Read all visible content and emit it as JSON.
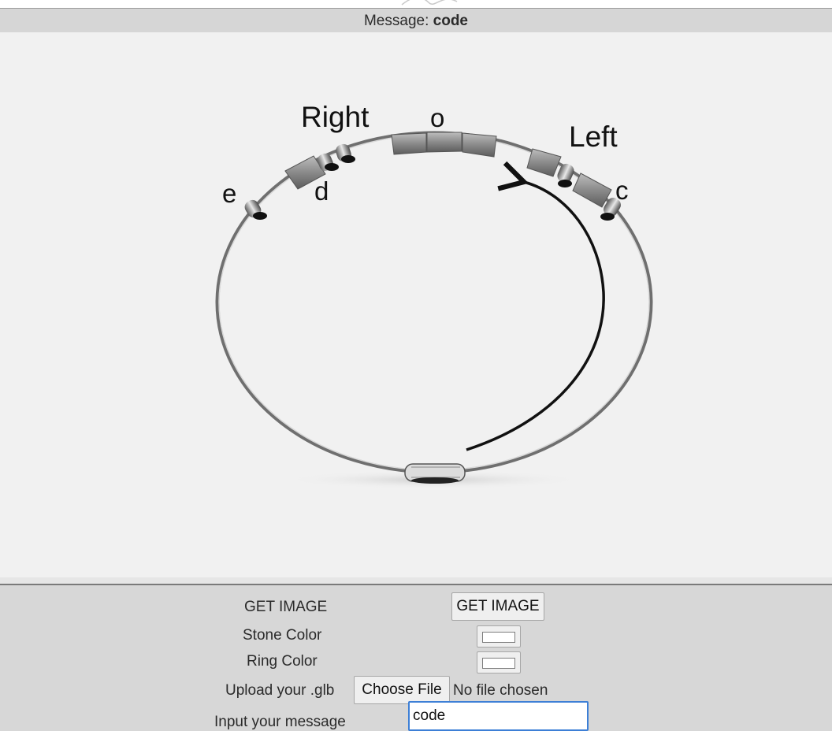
{
  "header": {
    "message_prefix": "Message:",
    "message_value": "code"
  },
  "viewer": {
    "labels": {
      "right": "Right",
      "left": "Left",
      "letter_e": "e",
      "letter_d": "d",
      "letter_o": "o",
      "letter_c": "c"
    }
  },
  "controls": {
    "get_image_label": "GET IMAGE",
    "get_image_button": "GET IMAGE",
    "stone_color_label": "Stone Color",
    "stone_color_value": "#ffffff",
    "ring_color_label": "Ring Color",
    "ring_color_value": "#ffffff",
    "upload_label": "Upload your .glb",
    "choose_file_button": "Choose File",
    "no_file_text": "No file chosen",
    "message_label": "Input your message",
    "message_value": "code"
  }
}
